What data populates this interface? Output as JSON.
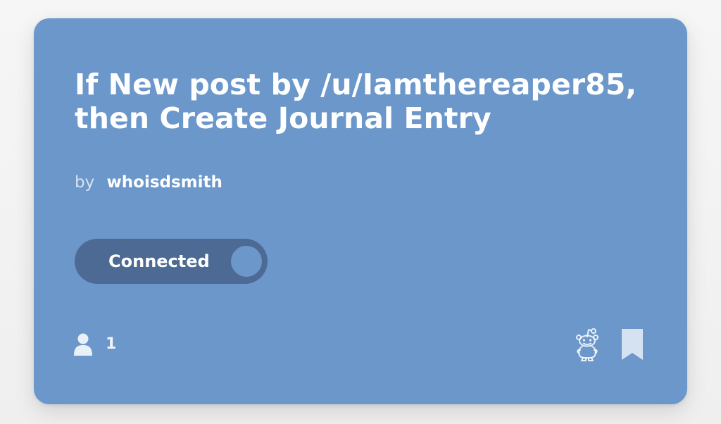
{
  "card": {
    "title": "If New post by /u/Iamthereaper85, then Create Journal Entry",
    "byline_prefix": "by",
    "author": "whoisdsmith",
    "toggle_label": "Connected",
    "users_count": "1",
    "colors": {
      "card_bg": "#6b97ca",
      "toggle_bg": "#4c6a93",
      "text": "#ffffff"
    },
    "icons": {
      "users": "user-icon",
      "service": "reddit-icon",
      "save": "bookmark-icon"
    }
  }
}
